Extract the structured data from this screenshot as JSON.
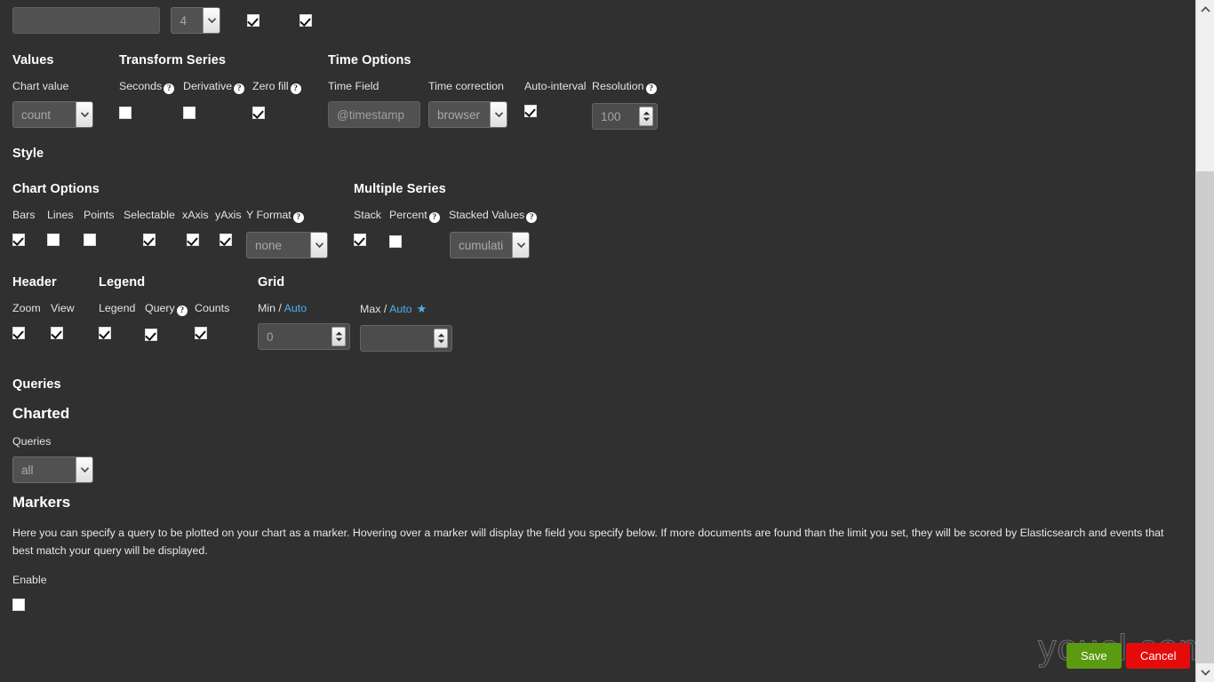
{
  "topbar": {
    "text_input_value": "",
    "text_input_placeholder": "",
    "span_select_value": "4",
    "checkbox_a": true,
    "checkbox_b": true
  },
  "values": {
    "heading": "Values",
    "chart_value_label": "Chart value",
    "chart_value_selected": "count"
  },
  "transform_series": {
    "heading": "Transform Series",
    "fields": [
      {
        "label": "Seconds",
        "help": "?",
        "checked": false
      },
      {
        "label": "Derivative",
        "help": "?",
        "checked": false
      },
      {
        "label": "Zero fill",
        "help": "?",
        "checked": true
      }
    ]
  },
  "time_options": {
    "heading": "Time Options",
    "time_field_label": "Time Field",
    "time_field_value": "@timestamp",
    "time_correction_label": "Time correction",
    "time_correction_selected": "browser",
    "auto_interval_label": "Auto-interval",
    "auto_interval_checked": true,
    "resolution_label": "Resolution",
    "resolution_help": "?",
    "resolution_value": "100"
  },
  "style": {
    "heading": "Style"
  },
  "chart_options": {
    "heading": "Chart Options",
    "checkboxes": [
      {
        "label": "Bars",
        "checked": true
      },
      {
        "label": "Lines",
        "checked": false
      },
      {
        "label": "Points",
        "checked": false
      },
      {
        "label": "Selectable",
        "checked": true
      },
      {
        "label": "xAxis",
        "checked": true
      },
      {
        "label": "yAxis",
        "checked": true
      }
    ],
    "y_format_label": "Y Format",
    "y_format_help": "?",
    "y_format_selected": "none"
  },
  "multiple_series": {
    "heading": "Multiple Series",
    "stack_label": "Stack",
    "stack_checked": true,
    "percent_label": "Percent",
    "percent_help": "?",
    "percent_checked": false,
    "stacked_values_label": "Stacked Values",
    "stacked_values_help": "?",
    "stacked_values_selected": "cumulati"
  },
  "header": {
    "heading": "Header",
    "items": [
      {
        "label": "Zoom",
        "checked": true
      },
      {
        "label": "View",
        "checked": true
      }
    ]
  },
  "legend": {
    "heading": "Legend",
    "items": [
      {
        "label": "Legend",
        "help": "",
        "checked": true
      },
      {
        "label": "Query",
        "help": "?",
        "checked": true
      },
      {
        "label": "Counts",
        "help": "",
        "checked": true
      }
    ]
  },
  "grid": {
    "heading": "Grid",
    "min_label": "Min",
    "min_sep": " / ",
    "min_auto": "Auto",
    "min_value": "0",
    "max_label": "Max",
    "max_sep": " / ",
    "max_auto": "Auto",
    "max_star": "★",
    "max_value": ""
  },
  "queries": {
    "heading": "Queries",
    "charted_heading": "Charted",
    "queries_label": "Queries",
    "queries_selected": "all"
  },
  "markers": {
    "heading": "Markers",
    "description": "Here you can specify a query to be plotted on your chart as a marker. Hovering over a marker will display the field you specify below. If more documents are found than the limit you set, they will be scored by Elasticsearch and events that best match your query will be displayed.",
    "enable_label": "Enable",
    "enable_checked": false
  },
  "footer": {
    "save_label": "Save",
    "cancel_label": "Cancel"
  },
  "watermark": {
    "text": "youcl.com"
  },
  "colors": {
    "background": "#303030",
    "accent_link": "#4db2e8",
    "save": "#5b9b10",
    "cancel": "#e60b0b"
  }
}
